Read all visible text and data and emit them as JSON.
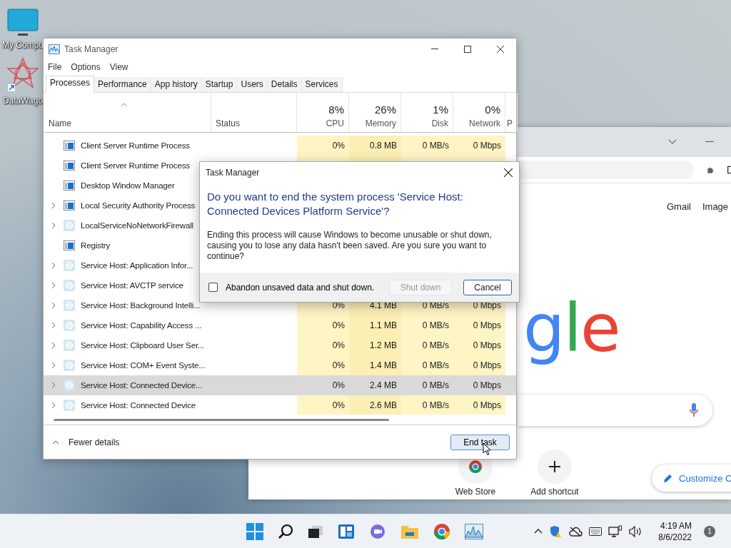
{
  "desktop_icons": [
    {
      "label": "My Compu",
      "kind": "monitor"
    },
    {
      "label": "DataWago",
      "kind": "shortcut"
    }
  ],
  "browser": {
    "links": [
      "Gmail",
      "Image"
    ],
    "logo": [
      {
        "letter": "g",
        "color": "#4285f4"
      },
      {
        "letter": "l",
        "color": "#34a853"
      },
      {
        "letter": "e",
        "color": "#ea4335"
      }
    ],
    "shortcuts": [
      {
        "label": "Web Store",
        "kind": "store"
      },
      {
        "label": "Add shortcut",
        "kind": "add"
      }
    ],
    "customize": "Customize C"
  },
  "task_manager": {
    "title": "Task Manager",
    "menu": [
      "File",
      "Options",
      "View"
    ],
    "tabs": [
      {
        "label": "Processes",
        "selected": true
      },
      {
        "label": "Performance",
        "selected": false
      },
      {
        "label": "App history",
        "selected": false
      },
      {
        "label": "Startup",
        "selected": false
      },
      {
        "label": "Users",
        "selected": false
      },
      {
        "label": "Details",
        "selected": false
      },
      {
        "label": "Services",
        "selected": false
      }
    ],
    "name_header": "Name",
    "status_header": "Status",
    "metrics": [
      {
        "percent": "8%",
        "label": "CPU"
      },
      {
        "percent": "26%",
        "label": "Memory"
      },
      {
        "percent": "1%",
        "label": "Disk"
      },
      {
        "percent": "0%",
        "label": "Network"
      }
    ],
    "column_8": "P",
    "rows": [
      {
        "name": "Client Server Runtime Process",
        "kind": "window",
        "expandable": false,
        "selected": false,
        "values": [
          "0%",
          "0.8 MB",
          "0 MB/s",
          "0 Mbps"
        ]
      },
      {
        "name": "Client Server Runtime Process",
        "kind": "window",
        "expandable": false,
        "selected": false
      },
      {
        "name": "Desktop Window Manager",
        "kind": "window",
        "expandable": false,
        "selected": false
      },
      {
        "name": "Local Security Authority Process",
        "kind": "window",
        "expandable": true,
        "selected": false
      },
      {
        "name": "LocalServiceNoNetworkFirewall",
        "kind": "gear",
        "expandable": true,
        "selected": false
      },
      {
        "name": "Registry",
        "kind": "window",
        "expandable": false,
        "selected": false
      },
      {
        "name": "Service Host: Application Infor...",
        "kind": "gear",
        "expandable": true,
        "selected": false
      },
      {
        "name": "Service Host: AVCTP service",
        "kind": "gear",
        "expandable": true,
        "selected": false
      },
      {
        "name": "Service Host: Background Intelli...",
        "kind": "gear",
        "expandable": true,
        "selected": false,
        "values": [
          "0%",
          "4.1 MB",
          "0 MB/s",
          "0 Mbps"
        ]
      },
      {
        "name": "Service Host: Capability Access ...",
        "kind": "gear",
        "expandable": true,
        "selected": false,
        "values": [
          "0%",
          "1.1 MB",
          "0 MB/s",
          "0 Mbps"
        ]
      },
      {
        "name": "Service Host: Clipboard User Ser...",
        "kind": "gear",
        "expandable": true,
        "selected": false,
        "values": [
          "0%",
          "1.2 MB",
          "0 MB/s",
          "0 Mbps"
        ]
      },
      {
        "name": "Service Host: COM+ Event Syste...",
        "kind": "gear",
        "expandable": true,
        "selected": false,
        "values": [
          "0%",
          "1.4 MB",
          "0 MB/s",
          "0 Mbps"
        ]
      },
      {
        "name": "Service Host: Connected Device...",
        "kind": "gear",
        "expandable": true,
        "selected": true,
        "values": [
          "0%",
          "2.4 MB",
          "0 MB/s",
          "0 Mbps"
        ]
      },
      {
        "name": "Service Host: Connected Device",
        "kind": "gear",
        "expandable": true,
        "selected": false,
        "values": [
          "0%",
          "2.6 MB",
          "0 MB/s",
          "0 Mbps"
        ]
      }
    ],
    "fewer_details": "Fewer details",
    "end_task": "End task"
  },
  "dialog": {
    "title": "Task Manager",
    "heading": "Do you want to end the system process 'Service Host: Connected Devices Platform Service'?",
    "message": "Ending this process will cause Windows to become unusable or shut down, causing you to lose any data hasn't been saved. Are you sure you want to continue?",
    "checkbox": {
      "label": "Abandon unsaved data and shut down.",
      "checked": false
    },
    "buttons": [
      {
        "label": "Shut down",
        "disabled": true,
        "focused": false
      },
      {
        "label": "Cancel",
        "disabled": false,
        "focused": true
      }
    ]
  },
  "taskbar": {
    "time": "4:19 AM",
    "date": "8/6/2022",
    "badge": "1"
  }
}
